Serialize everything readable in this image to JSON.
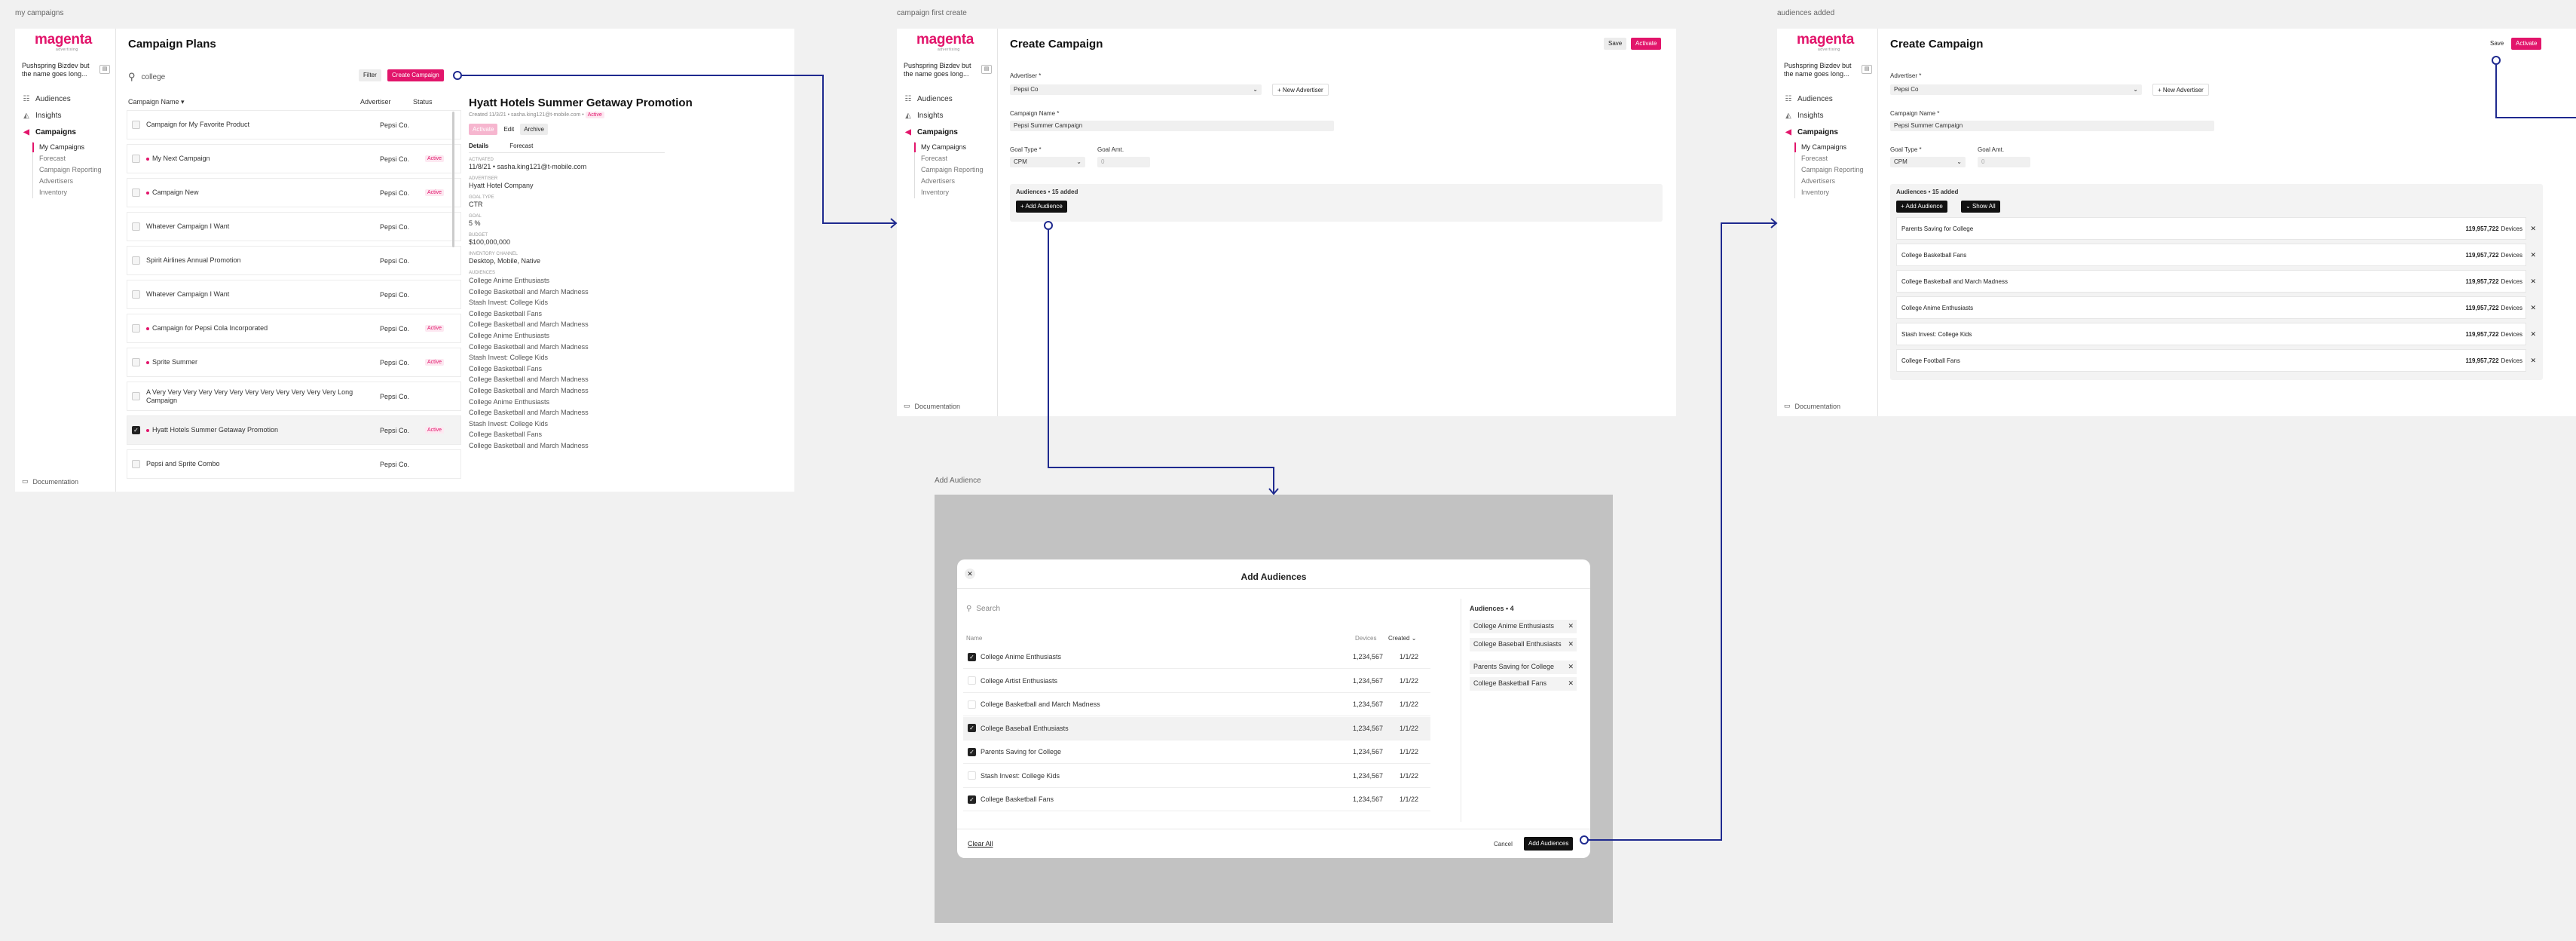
{
  "frames": {
    "f1": "my campaigns",
    "f2": "campaign first create",
    "f3": "audiences added",
    "f4": "Add Audience"
  },
  "sidebar": {
    "brand": "magenta",
    "brand_sub": "advertising",
    "org": "Pushspring Bizdev but the name goes long...",
    "nav": [
      "Audiences",
      "Insights",
      "Campaigns"
    ],
    "subnav": [
      "My Campaigns",
      "Forecast",
      "Campaign Reporting",
      "Advertisers",
      "Inventory"
    ],
    "documentation": "Documentation"
  },
  "plans": {
    "title": "Campaign Plans",
    "search_value": "college",
    "filter": "Filter",
    "create": "Create Campaign",
    "col_name": "Campaign Name",
    "col_adv": "Advertiser",
    "col_status": "Status",
    "rows": [
      {
        "name": "Campaign for My Favorite Product",
        "adv": "Pepsi Co.",
        "status": "",
        "dot": false,
        "checked": false
      },
      {
        "name": "My Next Campaign",
        "adv": "Pepsi Co.",
        "status": "Active",
        "dot": true,
        "checked": false
      },
      {
        "name": "Campaign New",
        "adv": "Pepsi Co.",
        "status": "Active",
        "dot": true,
        "checked": false
      },
      {
        "name": "Whatever Campaign I Want",
        "adv": "Pepsi Co.",
        "status": "",
        "dot": false,
        "checked": false
      },
      {
        "name": "Spirit Airlines Annual Promotion",
        "adv": "Pepsi Co.",
        "status": "",
        "dot": false,
        "checked": false
      },
      {
        "name": "Whatever Campaign I Want",
        "adv": "Pepsi Co.",
        "status": "",
        "dot": false,
        "checked": false
      },
      {
        "name": "Campaign for Pepsi Cola Incorporated",
        "adv": "Pepsi Co.",
        "status": "Active",
        "dot": true,
        "checked": false
      },
      {
        "name": "Sprite Summer",
        "adv": "Pepsi Co.",
        "status": "Active",
        "dot": true,
        "checked": false
      },
      {
        "name": "A Very Very Very Very Very Very Very Very Very Very Very Very Long Campaign",
        "adv": "Pepsi Co.",
        "status": "",
        "dot": false,
        "checked": false
      },
      {
        "name": "Hyatt Hotels Summer Getaway Promotion",
        "adv": "Pepsi Co.",
        "status": "Active",
        "dot": true,
        "checked": true
      },
      {
        "name": "Pepsi and Sprite Combo",
        "adv": "Pepsi Co.",
        "status": "",
        "dot": false,
        "checked": false
      }
    ],
    "detail": {
      "title": "Hyatt Hotels Summer Getaway Promotion",
      "meta": "Created 11/3/21 • sasha.king121@t-mobile.com •",
      "meta_status": "Active",
      "actions": [
        "Activate",
        "Edit",
        "Archive"
      ],
      "tabs": [
        "Details",
        "Forecast"
      ],
      "fields": [
        {
          "label": "Activated",
          "value": "11/8/21 • sasha.king121@t-mobile.com"
        },
        {
          "label": "Advertiser",
          "value": "Hyatt Hotel Company"
        },
        {
          "label": "Goal Type",
          "value": "CTR"
        },
        {
          "label": "Goal",
          "value": "5 %"
        },
        {
          "label": "Budget",
          "value": "$100,000,000"
        },
        {
          "label": "Inventory Channel",
          "value": "Desktop, Mobile, Native"
        }
      ],
      "aud_label": "Audiences",
      "audiences": [
        "College Anime Enthusiasts",
        "College Basketball and March Madness",
        "Stash Invest: College Kids",
        "College Basketball Fans",
        "College Basketball and March Madness",
        "College Anime Enthusiasts",
        "College Basketball and March Madness",
        "Stash Invest: College Kids",
        "College Basketball Fans",
        "College Basketball and March Madness",
        "College Basketball and March Madness",
        "College Anime Enthusiasts",
        "College Basketball and March Madness",
        "Stash Invest: College Kids",
        "College Basketball Fans",
        "College Basketball and March Madness"
      ]
    }
  },
  "create": {
    "title": "Create Campaign",
    "save": "Save",
    "activate": "Activate",
    "advertiser_label": "Advertiser *",
    "advertiser_value": "Pepsi Co",
    "new_advertiser": "New Advertiser",
    "name_label": "Campaign Name *",
    "name_value": "Pepsi Summer Campaign",
    "goal_type_label": "Goal Type *",
    "goal_type_value": "CPM",
    "goal_amt_label": "Goal Amt.",
    "goal_amt_value": "0",
    "audiences_header": "Audiences • 15 added",
    "add_audience": "Add Audience",
    "show_all": "Show All",
    "added": [
      {
        "name": "Parents Saving for College",
        "devices": "119,957,722",
        "unit": "Devices"
      },
      {
        "name": "College Basketball Fans",
        "devices": "119,957,722",
        "unit": "Devices"
      },
      {
        "name": "College Basketball and March Madness",
        "devices": "119,957,722",
        "unit": "Devices"
      },
      {
        "name": "College Anime Enthusiasts",
        "devices": "119,957,722",
        "unit": "Devices"
      },
      {
        "name": "Stash Invest: College Kids",
        "devices": "119,957,722",
        "unit": "Devices"
      },
      {
        "name": "College Football Fans",
        "devices": "119,957,722",
        "unit": "Devices"
      }
    ]
  },
  "modal": {
    "title": "Add Audiences",
    "search_placeholder": "Search",
    "col_name": "Name",
    "col_devices": "Devices",
    "col_created": "Created",
    "rows": [
      {
        "name": "College Anime Enthusiasts",
        "devices": "1,234,567",
        "created": "1/1/22",
        "checked": true,
        "hl": false
      },
      {
        "name": "College Artist Enthusiasts",
        "devices": "1,234,567",
        "created": "1/1/22",
        "checked": false,
        "hl": false
      },
      {
        "name": "College Basketball and March Madness",
        "devices": "1,234,567",
        "created": "1/1/22",
        "checked": false,
        "hl": false
      },
      {
        "name": "College Baseball Enthusiasts",
        "devices": "1,234,567",
        "created": "1/1/22",
        "checked": true,
        "hl": true
      },
      {
        "name": "Parents Saving for College",
        "devices": "1,234,567",
        "created": "1/1/22",
        "checked": true,
        "hl": false
      },
      {
        "name": "Stash Invest: College Kids",
        "devices": "1,234,567",
        "created": "1/1/22",
        "checked": false,
        "hl": false
      },
      {
        "name": "College Basketball Fans",
        "devices": "1,234,567",
        "created": "1/1/22",
        "checked": true,
        "hl": false
      }
    ],
    "selected_header": "Audiences • 4",
    "selected": [
      "College Anime Enthusiasts",
      "College Baseball Enthusiasts",
      "Parents Saving for College",
      "College Basketball Fans"
    ],
    "clear_all": "Clear All",
    "cancel": "Cancel",
    "add": "Add Audiences"
  },
  "colors": {
    "brand": "#e2156b",
    "connector": "#1f2a8f"
  }
}
